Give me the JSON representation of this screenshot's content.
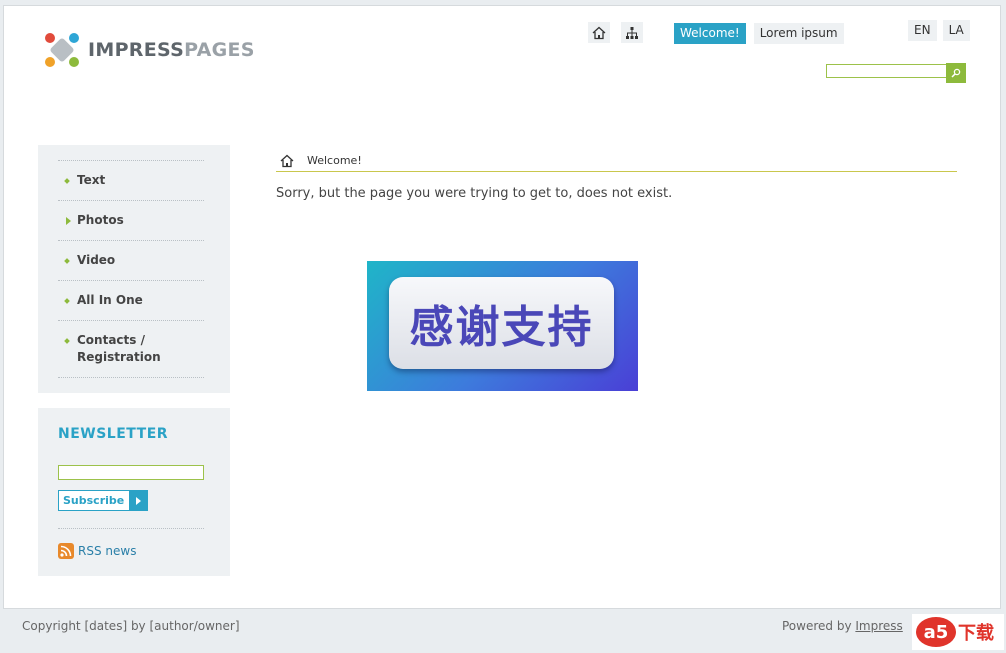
{
  "logo": {
    "part1": "IMPRESS",
    "part2": "PAGES"
  },
  "header": {
    "home_icon": "home-icon",
    "sitemap_icon": "sitemap-icon",
    "nav": [
      {
        "label": "Welcome!",
        "active": true
      },
      {
        "label": "Lorem ipsum",
        "active": false
      }
    ],
    "languages": [
      "EN",
      "LA"
    ],
    "search": {
      "placeholder": "",
      "button_icon": "search-icon"
    }
  },
  "sidebar": {
    "items": [
      {
        "label": "Text"
      },
      {
        "label": "Photos"
      },
      {
        "label": "Video"
      },
      {
        "label": "All In One"
      },
      {
        "label": "Contacts /",
        "label2": "Registration"
      }
    ]
  },
  "newsletter": {
    "title": "NEWSLETTER",
    "input_value": "",
    "subscribe_label": "Subscribe",
    "rss_label": "RSS news"
  },
  "main": {
    "breadcrumb": "Welcome!",
    "error_message": "Sorry, but the page you were trying to get to, does not exist.",
    "banner_text": "感谢支持"
  },
  "footer": {
    "copyright": "Copyright [dates] by [author/owner]",
    "powered_by": "Powered by",
    "powered_link": "Impress",
    "watermark": "下载"
  },
  "colors": {
    "accent_blue": "#2aa2c6",
    "accent_green": "#8dba3c",
    "panel_bg": "#eef1f3"
  }
}
